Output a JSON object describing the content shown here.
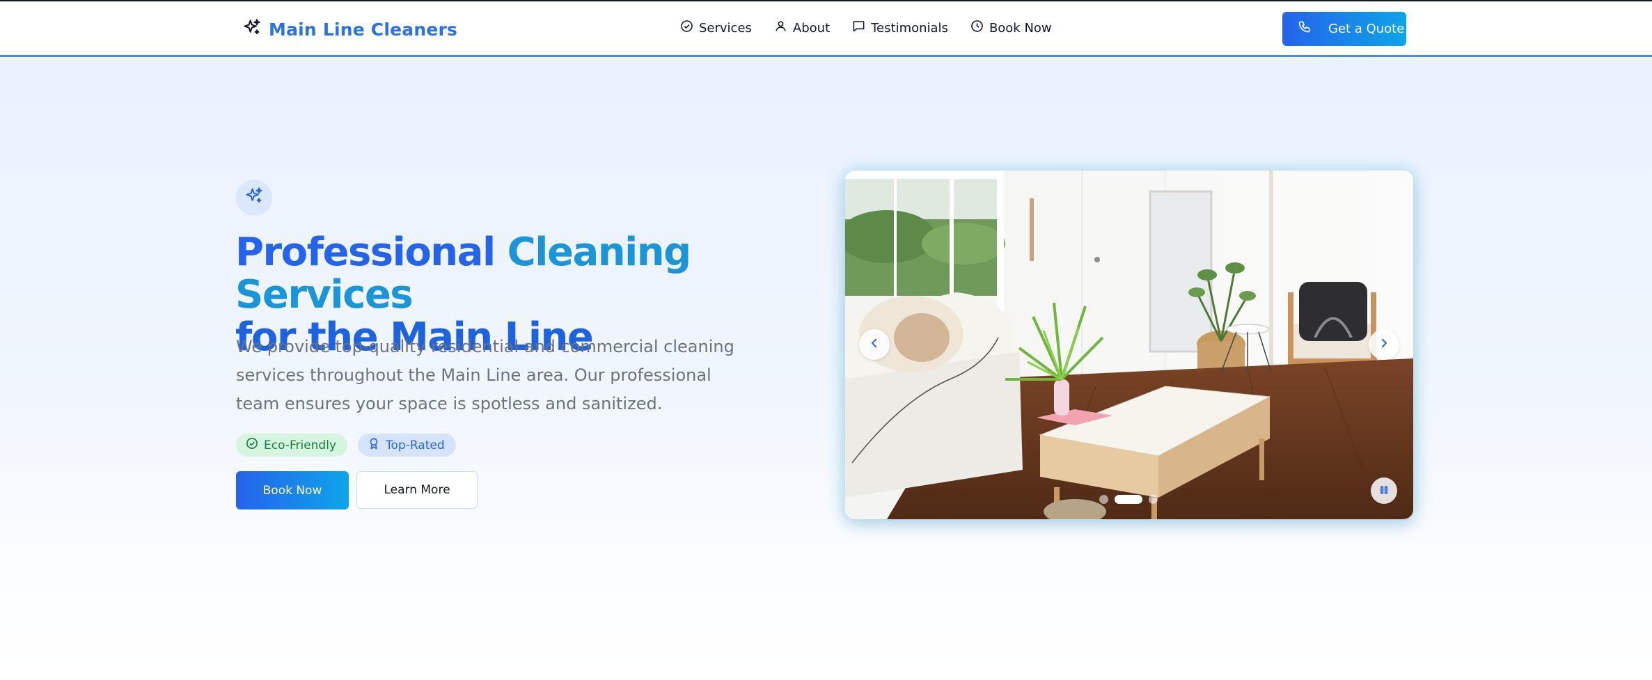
{
  "header": {
    "logo_text": "Main Line Cleaners",
    "nav": [
      {
        "label": "Services",
        "icon": "check-circle-icon"
      },
      {
        "label": "About",
        "icon": "user-icon"
      },
      {
        "label": "Testimonials",
        "icon": "message-square-icon"
      },
      {
        "label": "Book Now",
        "icon": "clock-icon"
      }
    ],
    "cta_label": "Get a Quote",
    "cta_icon": "phone-icon"
  },
  "hero": {
    "icon": "sparkles-icon",
    "title_part1": "Professional",
    "title_part2": "Cleaning Services",
    "title_part3": "for the Main Line",
    "description": "We provide top-quality residential and commercial cleaning services throughout the Main Line area. Our professional team ensures your space is spotless and sanitized.",
    "badges": [
      {
        "label": "Eco-Friendly",
        "icon": "check-circle-icon"
      },
      {
        "label": "Top-Rated",
        "icon": "award-icon"
      }
    ],
    "primary_button": "Book Now",
    "secondary_button": "Learn More"
  },
  "carousel": {
    "slide_count": 3,
    "active_slide": 2,
    "slide_description": "Bright living room with white sofa, wooden coffee table, palm plant and hardwood floor"
  },
  "colors": {
    "brand_blue": "#2563eb",
    "accent_cyan": "#0ea5e9",
    "eco_green": "#15803d"
  }
}
